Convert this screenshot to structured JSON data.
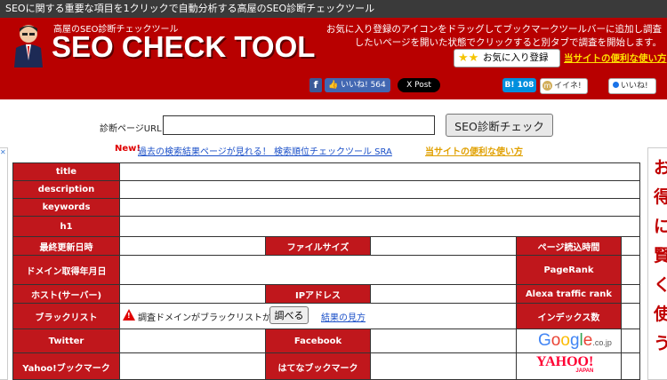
{
  "topbar": {
    "text": "SEOに関する重要な項目を1クリックで自動分析する高屋のSEO診断チェックツール"
  },
  "logo": {
    "small": "高屋のSEO診断チェックツール",
    "big": "SEO CHECK TOOL"
  },
  "banner": {
    "instructions": "お気に入り登録のアイコンをドラッグしてブックマークツールバーに追加し調査したいページを開いた状態でクリックすると別タブで調査を開始します。",
    "favorite_button": "お気に入り登録",
    "usage_link": "当サイトの便利な使い方"
  },
  "social": {
    "fb_like": "いいね! 564",
    "x_post": "X Post",
    "hatena": "B! 108",
    "mixi": "イイネ!",
    "gplus": "いいね!"
  },
  "form": {
    "url_label": "診断ページURL",
    "url_value": "",
    "check_button": "SEO診断チェック"
  },
  "links": {
    "new_tag": "New!",
    "sra": "過去の検索結果ページが見れる！ 検索順位チェックツール SRA",
    "usage": "当サイトの便利な使い方"
  },
  "table": {
    "title": "title",
    "description": "description",
    "keywords": "keywords",
    "h1": "h1",
    "last_updated": "最終更新日時",
    "file_size": "ファイルサイズ",
    "load_time": "ページ読込時間",
    "domain_date": "ドメイン取得年月日",
    "pagerank": "PageRank",
    "host": "ホスト(サーバー)",
    "ip": "IPアドレス",
    "alexa": "Alexa traffic rank",
    "blacklist": "ブラックリスト",
    "blacklist_text": "調査ドメインがブラックリストか",
    "blacklist_button": "調べる",
    "blacklist_link": "結果の見方",
    "index_count": "インデックス数",
    "twitter": "Twitter",
    "facebook": "Facebook",
    "yahoo_bookmark": "Yahoo!ブックマーク",
    "hatena_bookmark": "はてなブックマーク",
    "google_logo": "Google",
    "google_sub": ".co.jp",
    "yahoo_logo": "YAHOO!",
    "yahoo_sub": "JAPAN"
  },
  "side_ad": {
    "text": "お得に賢く使う"
  },
  "colors": {
    "brand_red": "#b80000",
    "label_red": "#c0171c",
    "topbar": "#3a3a3a"
  }
}
